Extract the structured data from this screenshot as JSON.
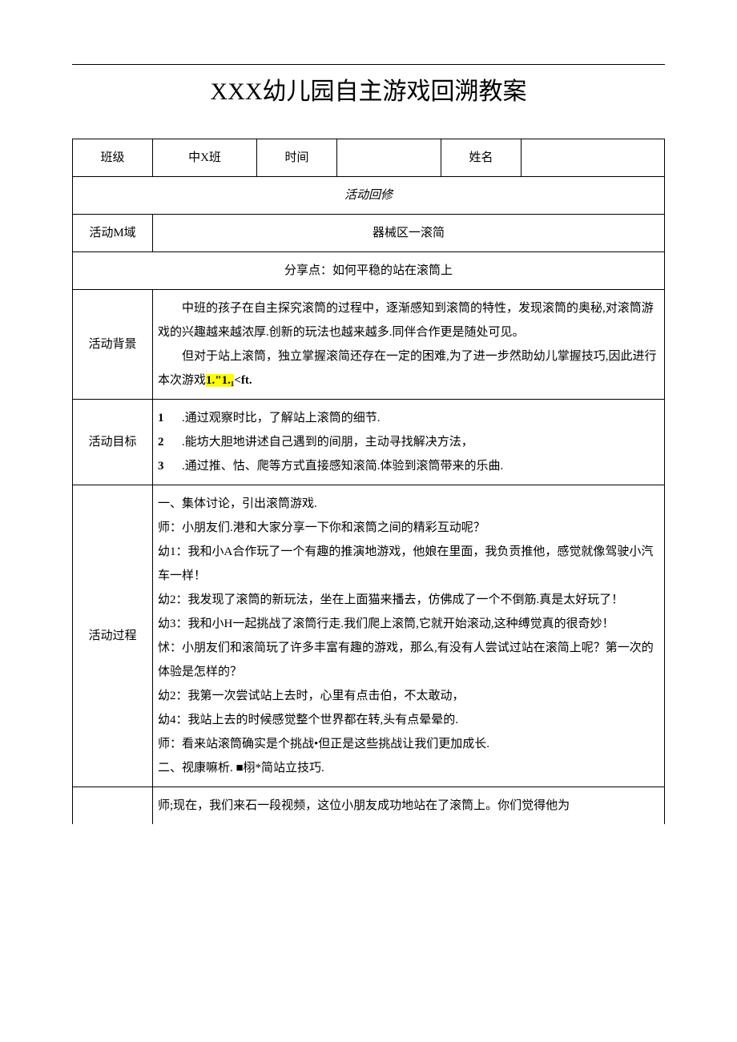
{
  "title": "XXX幼儿园自主游戏回溯教案",
  "header": {
    "class_label": "班级",
    "class_value": "中X班",
    "time_label": "时间",
    "time_value": "",
    "name_label": "姓名",
    "name_value": ""
  },
  "section_label": "活动回修",
  "area": {
    "label": "活动M域",
    "value": "器械区一滚简"
  },
  "share_point": "分享点：如何平稳的站在滚筒上",
  "background": {
    "label": "活动背景",
    "p1": "中班的孩子在自主探究滚筒的过程中，逐渐感知到滚筒的特性，发现滚筒的奥秘,对滚筒游戏的兴趣越来越浓厚.创新的玩法也越来越多.同伴合作更是随处可见。",
    "p2_pre": "但对于站上滚筒，独立掌握滚简还存在一定的困难,为了进一步然助幼儿掌握技巧,因此进行本次游戏",
    "p2_hl": "1.\"1.₁",
    "p2_post": "<ft."
  },
  "goals": {
    "label": "活动目标",
    "items": [
      ".通过观察时比，了解站上滚筒的细节.",
      ".能坊大胆地讲述自己遇到的间朋，主动寻找解决方法，",
      ".通过推、怙、爬等方式直接感知滚简.体验到滚筒带来的乐曲."
    ]
  },
  "process": {
    "label": "活动过程",
    "lines": [
      "一、集体讨论，引出滚筒游戏.",
      "师：小朋友们.港和大家分享一下你和滚筒之间的精彩互动呢？",
      "幼1：我和小A合作玩了一个有趣的推演地游戏，他娘在里面，我负贡推他，感觉就像驾驶小汽车一样！",
      "幼2：我发现了滚筒的新玩法，坐在上面猫来播去，仿佛成了一个不倒筋.真是太好玩了！",
      "幼3：我和小H一起挑战了滚筒行走.我们爬上滚筒,它就开始滚动,这种缚觉真的很奇妙！",
      "怵：小朋友们和滚简玩了许多丰富有趣的游戏，那么,有没有人尝试过站在滚简上呢？第一次的体验是怎样的？",
      "幼2：我第一次尝试站上去时，心里有点击伯，不太敢动，",
      "幼4：我站上去的时候感觉整个世界都在转,头有点晕晕的.",
      "师：看来站滚筒确实是个挑战•但正是这些挑战让我们更加成长.",
      "二、视康嘛析. ■栩*简站立技巧."
    ]
  },
  "footer_line": "师;现在，我们来石一段视频，这位小朋友成功地站在了滚筒上。你们觉得他为"
}
